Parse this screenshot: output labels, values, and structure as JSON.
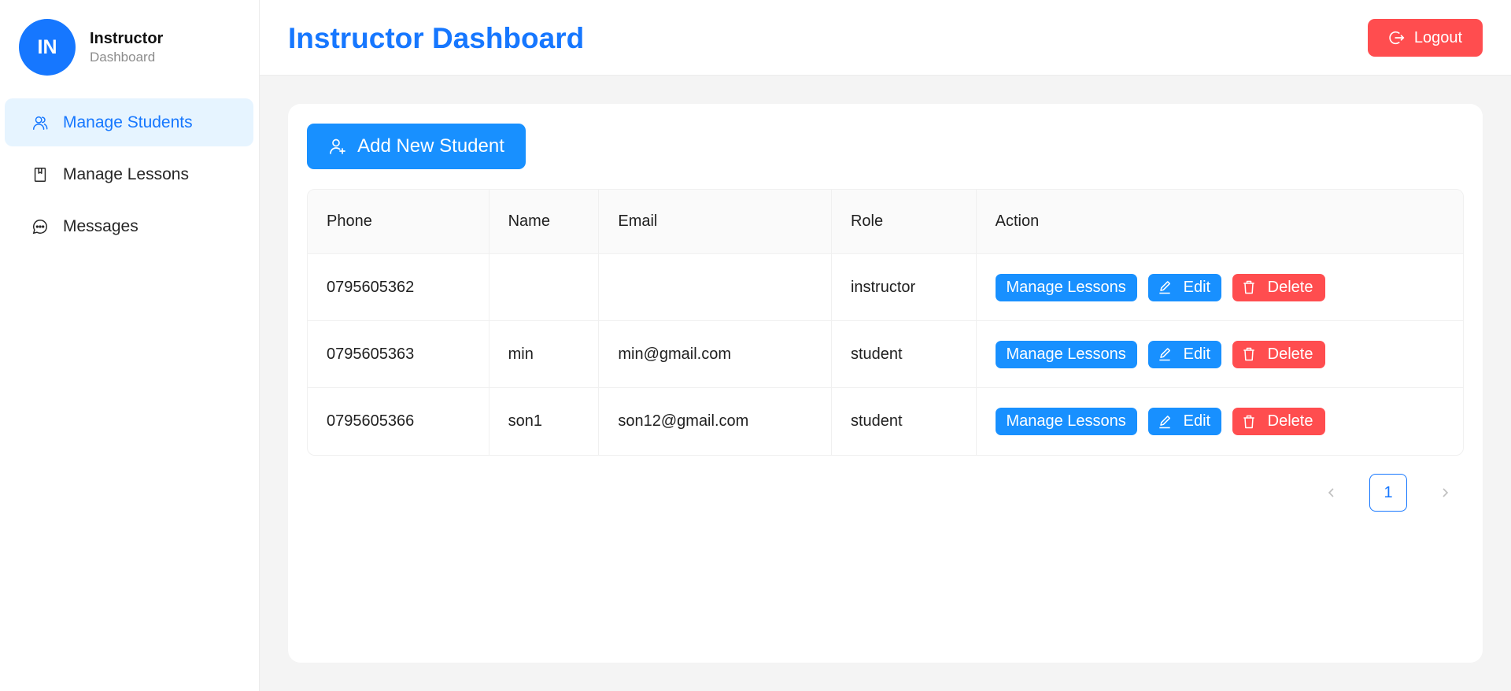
{
  "profile": {
    "initials": "IN",
    "name": "Instructor",
    "subtitle": "Dashboard"
  },
  "sidebar": {
    "items": [
      {
        "label": "Manage Students",
        "icon": "users-icon",
        "active": true
      },
      {
        "label": "Manage Lessons",
        "icon": "book-icon",
        "active": false
      },
      {
        "label": "Messages",
        "icon": "chat-icon",
        "active": false
      }
    ]
  },
  "header": {
    "title": "Instructor Dashboard",
    "logout_label": "Logout"
  },
  "main": {
    "add_button_label": "Add New Student",
    "table": {
      "columns": [
        "Phone",
        "Name",
        "Email",
        "Role",
        "Action"
      ],
      "rows": [
        {
          "phone": "0795605362",
          "name": "",
          "email": "",
          "role": "instructor"
        },
        {
          "phone": "0795605363",
          "name": "min",
          "email": "min@gmail.com",
          "role": "student"
        },
        {
          "phone": "0795605366",
          "name": "son1",
          "email": "son12@gmail.com",
          "role": "student"
        }
      ],
      "actions": {
        "manage": "Manage Lessons",
        "edit": "Edit",
        "delete": "Delete"
      }
    },
    "pagination": {
      "current_page": "1"
    }
  },
  "colors": {
    "primary": "#1677ff",
    "danger": "#ff4d4f",
    "active_bg": "#e6f4ff"
  }
}
